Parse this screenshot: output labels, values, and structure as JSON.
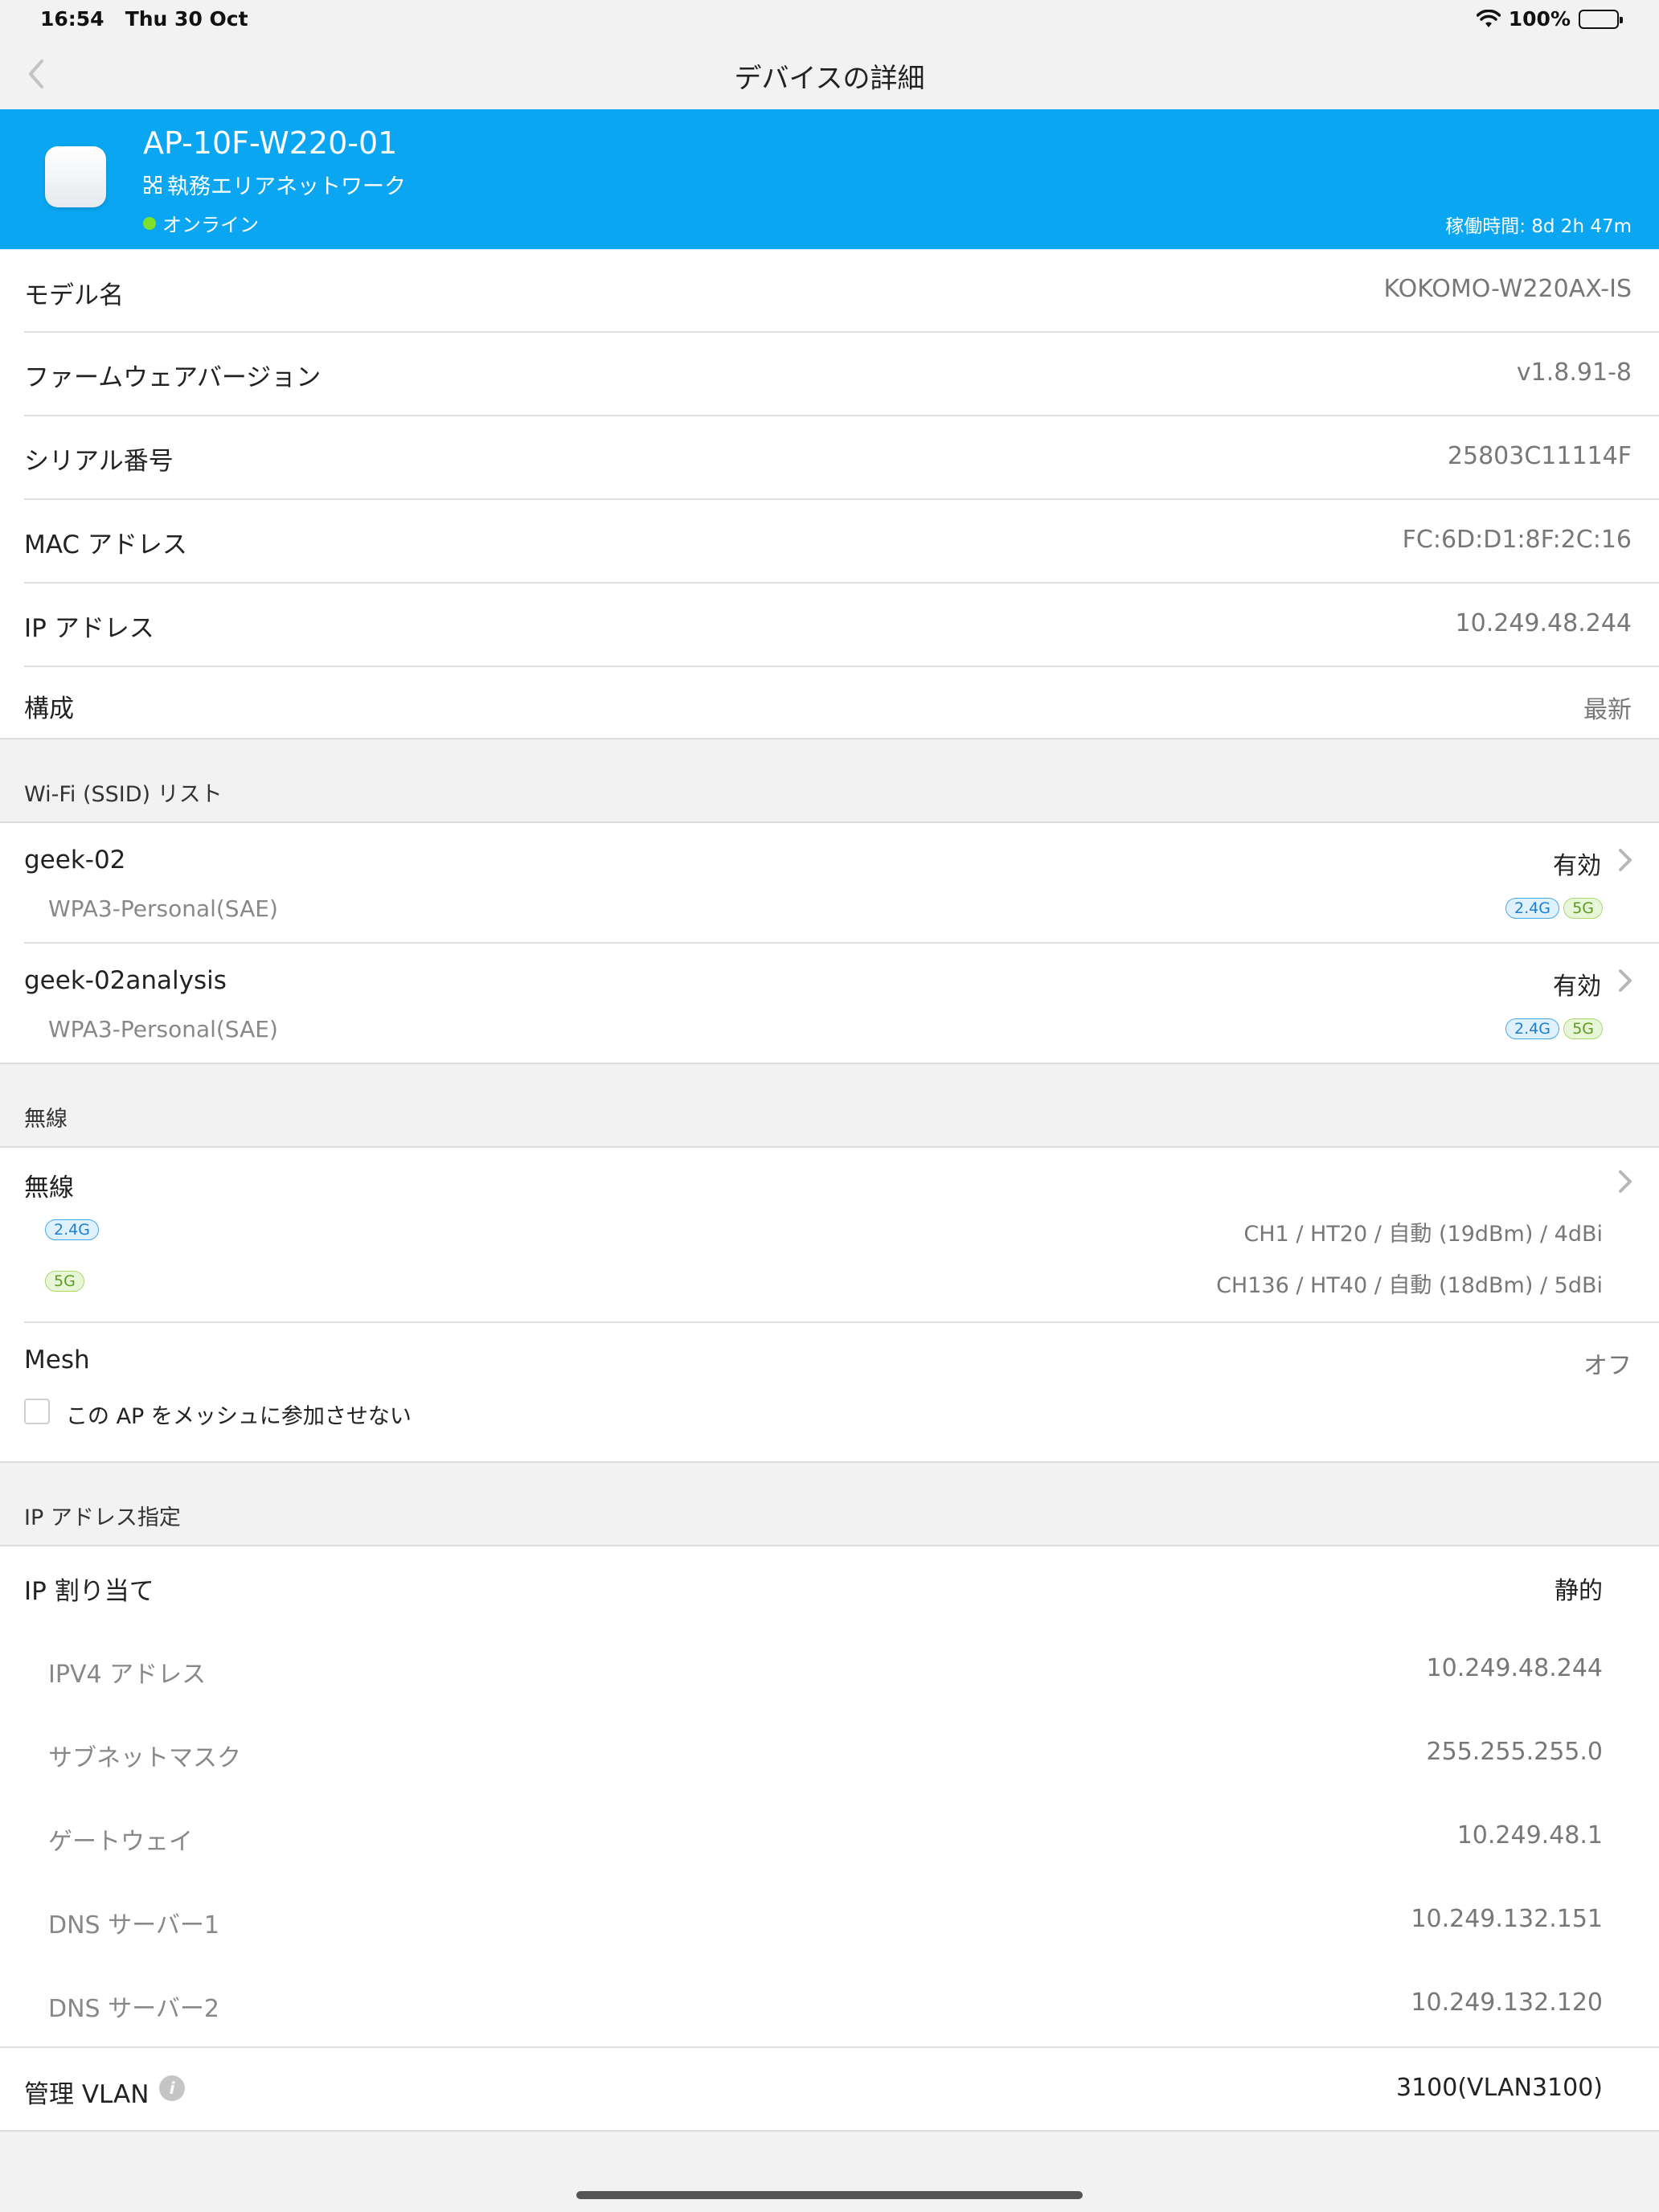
{
  "status_bar": {
    "time": "16:54",
    "date": "Thu 30 Oct",
    "battery": "100%"
  },
  "nav": {
    "title": "デバイスの詳細"
  },
  "device": {
    "name": "AP-10F-W220-01",
    "network": "執務エリアネットワーク",
    "status": "オンライン",
    "uptime": "稼働時間: 8d 2h 47m"
  },
  "info_rows": [
    {
      "label": "モデル名",
      "value": "KOKOMO-W220AX-IS"
    },
    {
      "label": "ファームウェアバージョン",
      "value": "v1.8.91-8"
    },
    {
      "label": "シリアル番号",
      "value": "25803C11114F"
    },
    {
      "label": "MAC アドレス",
      "value": "FC:6D:D1:8F:2C:16"
    },
    {
      "label": "IP アドレス",
      "value": "10.249.48.244"
    },
    {
      "label": "構成",
      "value": "最新"
    }
  ],
  "ssid_section": {
    "title": "Wi-Fi (SSID) リスト",
    "items": [
      {
        "name": "geek-02",
        "security": "WPA3-Personal(SAE)",
        "state": "有効",
        "band1": "2.4G",
        "band2": "5G"
      },
      {
        "name": "geek-02analysis",
        "security": "WPA3-Personal(SAE)",
        "state": "有効",
        "band1": "2.4G",
        "band2": "5G"
      }
    ]
  },
  "wireless_section": {
    "title": "無線",
    "row_label": "無線",
    "band_24": "2.4G",
    "band_24_value": "CH1 / HT20 / 自動 (19dBm) / 4dBi",
    "band_5": "5G",
    "band_5_value": "CH136 / HT40 / 自動 (18dBm) / 5dBi",
    "mesh_label": "Mesh",
    "mesh_value": "オフ",
    "mesh_checkbox_label": "この AP をメッシュに参加させない"
  },
  "ip_section": {
    "title": "IP アドレス指定",
    "assign_label": "IP 割り当て",
    "assign_value": "静的",
    "sub_rows": [
      {
        "label": "IPV4 アドレス",
        "value": "10.249.48.244"
      },
      {
        "label": "サブネットマスク",
        "value": "255.255.255.0"
      },
      {
        "label": "ゲートウェイ",
        "value": "10.249.48.1"
      },
      {
        "label": "DNS サーバー1",
        "value": "10.249.132.151"
      },
      {
        "label": "DNS サーバー2",
        "value": "10.249.132.120"
      }
    ],
    "vlan_label": "管理 VLAN",
    "vlan_value": "3100(VLAN3100)"
  }
}
